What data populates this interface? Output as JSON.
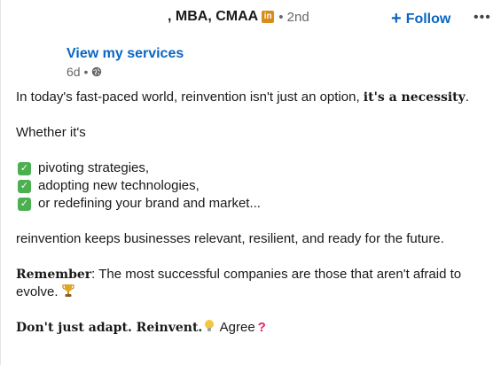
{
  "header": {
    "name_suffix": ", MBA, CMAA",
    "linkedin_badge": "in",
    "degree": "• 2nd",
    "follow_label": "Follow",
    "follow_icon": "plus-icon",
    "more_icon": "ellipsis-icon"
  },
  "subheader": {
    "services_link": "View my services",
    "time_ago": "6d •",
    "visibility_icon": "globe-icon"
  },
  "post": {
    "line1_prefix": "In today's fast-paced world, reinvention isn't just an option, ",
    "line1_bold": "it's a necessity",
    "line1_suffix": ".",
    "line2": "Whether it's",
    "checklist": [
      "pivoting strategies,",
      "adopting new technologies,",
      "or redefining your brand and market..."
    ],
    "line3": "reinvention keeps businesses relevant, resilient, and ready for the future.",
    "remember_label": "Remember",
    "remember_text": ":  The most successful companies are those that aren't afraid to evolve.",
    "closing_bold": "Don't just adapt. Reinvent.",
    "closing_text": " Agree",
    "colors": {
      "link": "#0a66c2",
      "check": "#4caf50",
      "badge": "#d98b1c"
    }
  }
}
